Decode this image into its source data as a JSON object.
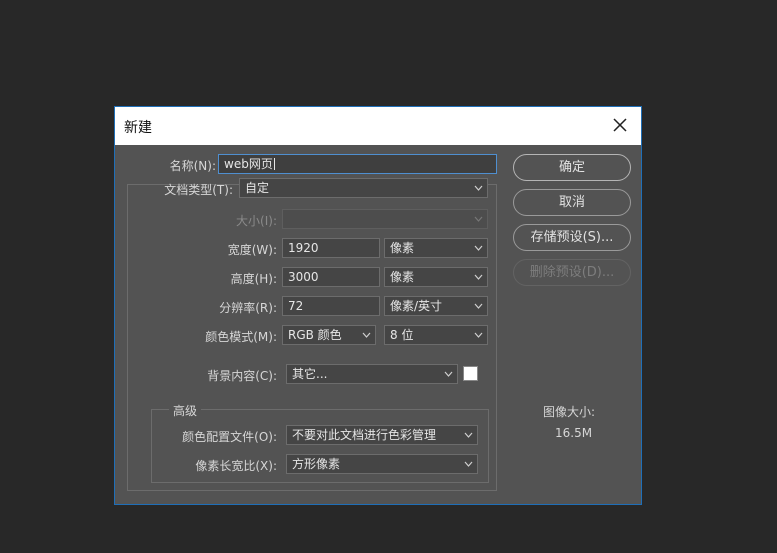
{
  "dialog": {
    "title": "新建",
    "name_label": "名称(N):",
    "name_value": "web网页",
    "doc_type_label": "文档类型(T):",
    "doc_type_value": "自定",
    "size_label": "大小(I):",
    "size_value": "",
    "width_label": "宽度(W):",
    "width_value": "1920",
    "width_unit": "像素",
    "height_label": "高度(H):",
    "height_value": "3000",
    "height_unit": "像素",
    "resolution_label": "分辨率(R):",
    "resolution_value": "72",
    "resolution_unit": "像素/英寸",
    "color_mode_label": "颜色模式(M):",
    "color_mode_value": "RGB 颜色",
    "bit_depth_value": "8 位",
    "background_label": "背景内容(C):",
    "background_value": "其它...",
    "background_color": "#ffffff",
    "advanced_label": "高级",
    "color_profile_label": "颜色配置文件(O):",
    "color_profile_value": "不要对此文档进行色彩管理",
    "pixel_aspect_label": "像素长宽比(X):",
    "pixel_aspect_value": "方形像素",
    "image_size_label": "图像大小:",
    "image_size_value": "16.5M"
  },
  "buttons": {
    "ok": "确定",
    "cancel": "取消",
    "save_preset": "存储预设(S)...",
    "delete_preset": "删除预设(D)..."
  },
  "icons": {
    "close": "close-icon",
    "dropdown": "chevron-down-icon"
  },
  "colors": {
    "background": "#282828",
    "dialog": "#535353",
    "accent": "#1f6fb8"
  }
}
